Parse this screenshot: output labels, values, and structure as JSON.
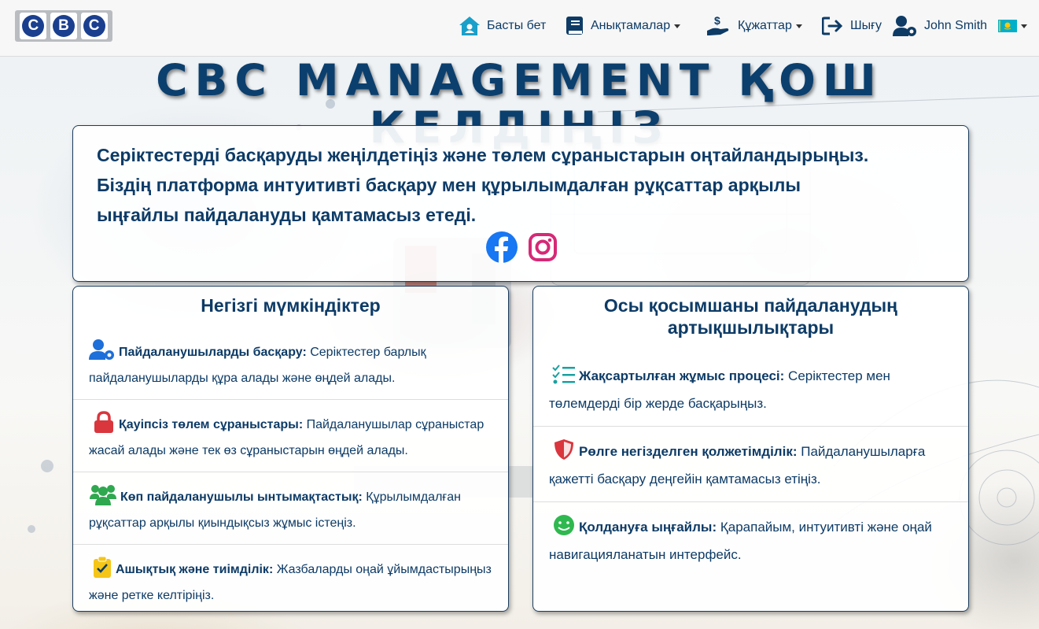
{
  "nav": {
    "logo_letters": [
      "C",
      "B",
      "C"
    ],
    "home_label": "Басты бет",
    "references_label": "Анықтамалар",
    "documents_label": "Құжаттар",
    "logout_label": "Шығу",
    "user_name": "John Smith",
    "language_flag": "kz-flag-icon"
  },
  "page_title": "CBC MANAGEMENT ҚОШ КЕЛДІҢІЗ",
  "intro": {
    "lines": [
      "Серіктестерді басқаруды жеңілдетіңіз және төлем сұраныстарын оңтайландырыңыз.",
      "Біздің платформа интуитивті басқару мен құрылымдалған рұқсаттар арқылы",
      "ыңғайлы пайдалануды қамтамасыз етеді."
    ],
    "social_icons": [
      "facebook-icon",
      "instagram-icon"
    ]
  },
  "features": {
    "title": "Негізгі мүмкіндіктер",
    "items": [
      {
        "icon": "user-gear-icon",
        "title": "Пайдаланушыларды басқару:",
        "text": " Серіктестер барлық пайдаланушыларды құра алады және өңдей алады."
      },
      {
        "icon": "lock-icon",
        "title": "Қауіпсіз төлем сұраныстары:",
        "text": " Пайдаланушылар сұраныстар жасай алады және тек өз сұраныстарын өңдей алады."
      },
      {
        "icon": "users-icon",
        "title": "Көп пайдаланушылы ынтымақтастық:",
        "text": " Құрылымдалған рұқсаттар арқылы қиындықсыз жұмыс істеңіз."
      },
      {
        "icon": "clipboard-check-icon",
        "title": "Ашықтық және тиімділік:",
        "text": " Жазбаларды оңай ұйымдастырыңыз және ретке келтіріңіз."
      }
    ]
  },
  "benefits": {
    "title": "Осы қосымшаны пайдаланудың артықшылықтары",
    "items": [
      {
        "icon": "list-check-icon",
        "title": "Жақсартылған жұмыс процесі:",
        "text": " Серіктестер мен төлемдерді бір жерде басқарыңыз."
      },
      {
        "icon": "shield-icon",
        "title": "Рөлге негізделген қолжетімділік:",
        "text": " Пайдаланушыларға қажетті басқару деңгейін қамтамасыз етіңіз."
      },
      {
        "icon": "smile-icon",
        "title": "Қолдануға ыңғайлы:",
        "text": " Қарапайым, интуитивті және оңай навигацияланатын интерфейс."
      }
    ]
  },
  "colors": {
    "primary": "#0d3b66",
    "home_icon": "#1aa0c9",
    "user_icon": "#1e6fd9",
    "lock_icon": "#d9363e",
    "users_icon": "#2fa84f",
    "clipboard_icon": "#f5c518",
    "list_icon": "#1aa0a0",
    "shield_icon": "#d9363e",
    "smile_icon": "#2fb84f"
  }
}
